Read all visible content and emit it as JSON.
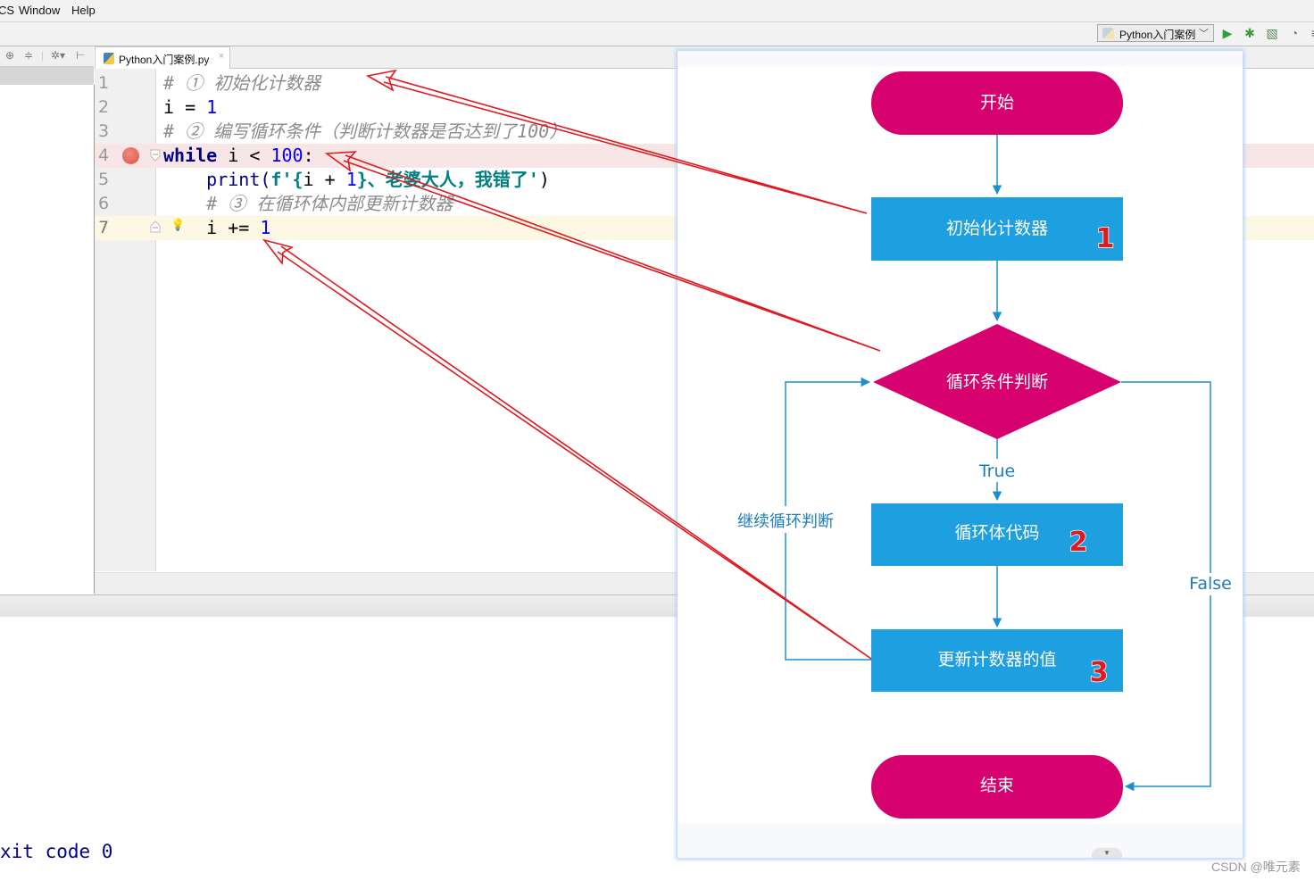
{
  "menu": {
    "items": [
      {
        "label": "CS",
        "mnemonic": "S"
      },
      {
        "label": "Window",
        "mnemonic": "W"
      },
      {
        "label": "Help",
        "mnemonic": "H"
      }
    ]
  },
  "toolbar": {
    "run_config": "Python入门案例",
    "icons": [
      "run-icon",
      "debug-icon",
      "coverage-icon",
      "profile-icon"
    ]
  },
  "project_panel": {
    "icons": [
      "target-icon",
      "collapse-icon",
      "gear-icon",
      "hide-icon"
    ]
  },
  "editor": {
    "tab_label": "Python入门案例.py",
    "tab_close": "×",
    "lines": [
      {
        "num": "1",
        "tokens": [
          {
            "t": "# ① 初始化计数器",
            "c": "cm"
          }
        ]
      },
      {
        "num": "2",
        "tokens": [
          {
            "t": "i = ",
            "c": "pl"
          },
          {
            "t": "1",
            "c": "num"
          }
        ]
      },
      {
        "num": "3",
        "tokens": [
          {
            "t": "# ② 编写循环条件（判断计数器是否达到了100）",
            "c": "cm"
          }
        ]
      },
      {
        "num": "4",
        "tokens": [
          {
            "t": "while",
            "c": "kw"
          },
          {
            "t": " i < ",
            "c": "pl"
          },
          {
            "t": "100",
            "c": "num"
          },
          {
            "t": ":",
            "c": "pl"
          }
        ]
      },
      {
        "num": "5",
        "tokens": [
          {
            "t": "    print(",
            "c": "fn"
          },
          {
            "t": "f'{",
            "c": "str"
          },
          {
            "t": "i + ",
            "c": "pl"
          },
          {
            "t": "1",
            "c": "num"
          },
          {
            "t": "}、老婆大人，我错了'",
            "c": "str"
          },
          {
            "t": ")",
            "c": "pl"
          }
        ]
      },
      {
        "num": "6",
        "tokens": [
          {
            "t": "    # ③ 在循环体内部更新计数器",
            "c": "cm"
          }
        ]
      },
      {
        "num": "7",
        "tokens": [
          {
            "t": "    i += ",
            "c": "pl"
          },
          {
            "t": "1",
            "c": "num"
          }
        ]
      }
    ],
    "breakpoint_line": 4,
    "current_line": 7
  },
  "console": {
    "exit_text": "xit code 0"
  },
  "flowchart": {
    "nodes": {
      "start": "开始",
      "init": "初始化计数器",
      "cond": "循环条件判断",
      "body": "循环体代码",
      "update": "更新计数器的值",
      "end": "结束"
    },
    "badges": {
      "init": "1",
      "body": "2",
      "update": "3"
    },
    "edge_labels": {
      "true": "True",
      "false": "False",
      "loop": "继续循环判断"
    },
    "colors": {
      "terminal": "#d6006e",
      "process": "#1d9fe0",
      "edge": "#1d8fd0",
      "annotation": "#e0191f"
    }
  },
  "watermark": "CSDN @唯元素"
}
